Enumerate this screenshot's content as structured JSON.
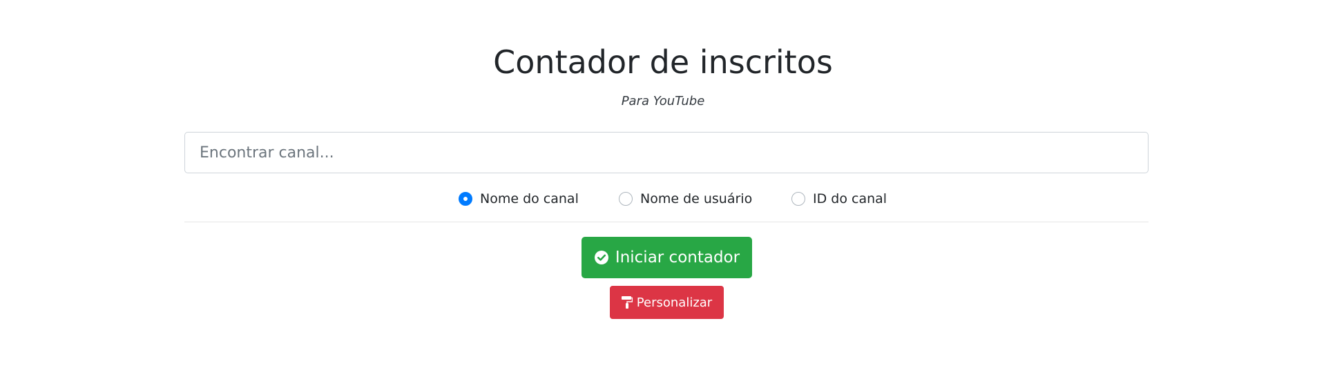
{
  "header": {
    "title": "Contador de inscritos",
    "subtitle": "Para YouTube"
  },
  "search": {
    "placeholder": "Encontrar canal...",
    "value": ""
  },
  "search_type": {
    "options": [
      {
        "label": "Nome do canal",
        "checked": true
      },
      {
        "label": "Nome de usuário",
        "checked": false
      },
      {
        "label": "ID do canal",
        "checked": false
      }
    ]
  },
  "actions": {
    "start_label": "Iniciar contador",
    "start_icon": "check-circle-icon",
    "customize_label": "Personalizar",
    "customize_icon": "paint-roller-icon"
  },
  "colors": {
    "primary": "#007bff",
    "success": "#28a745",
    "danger": "#dc3545"
  }
}
